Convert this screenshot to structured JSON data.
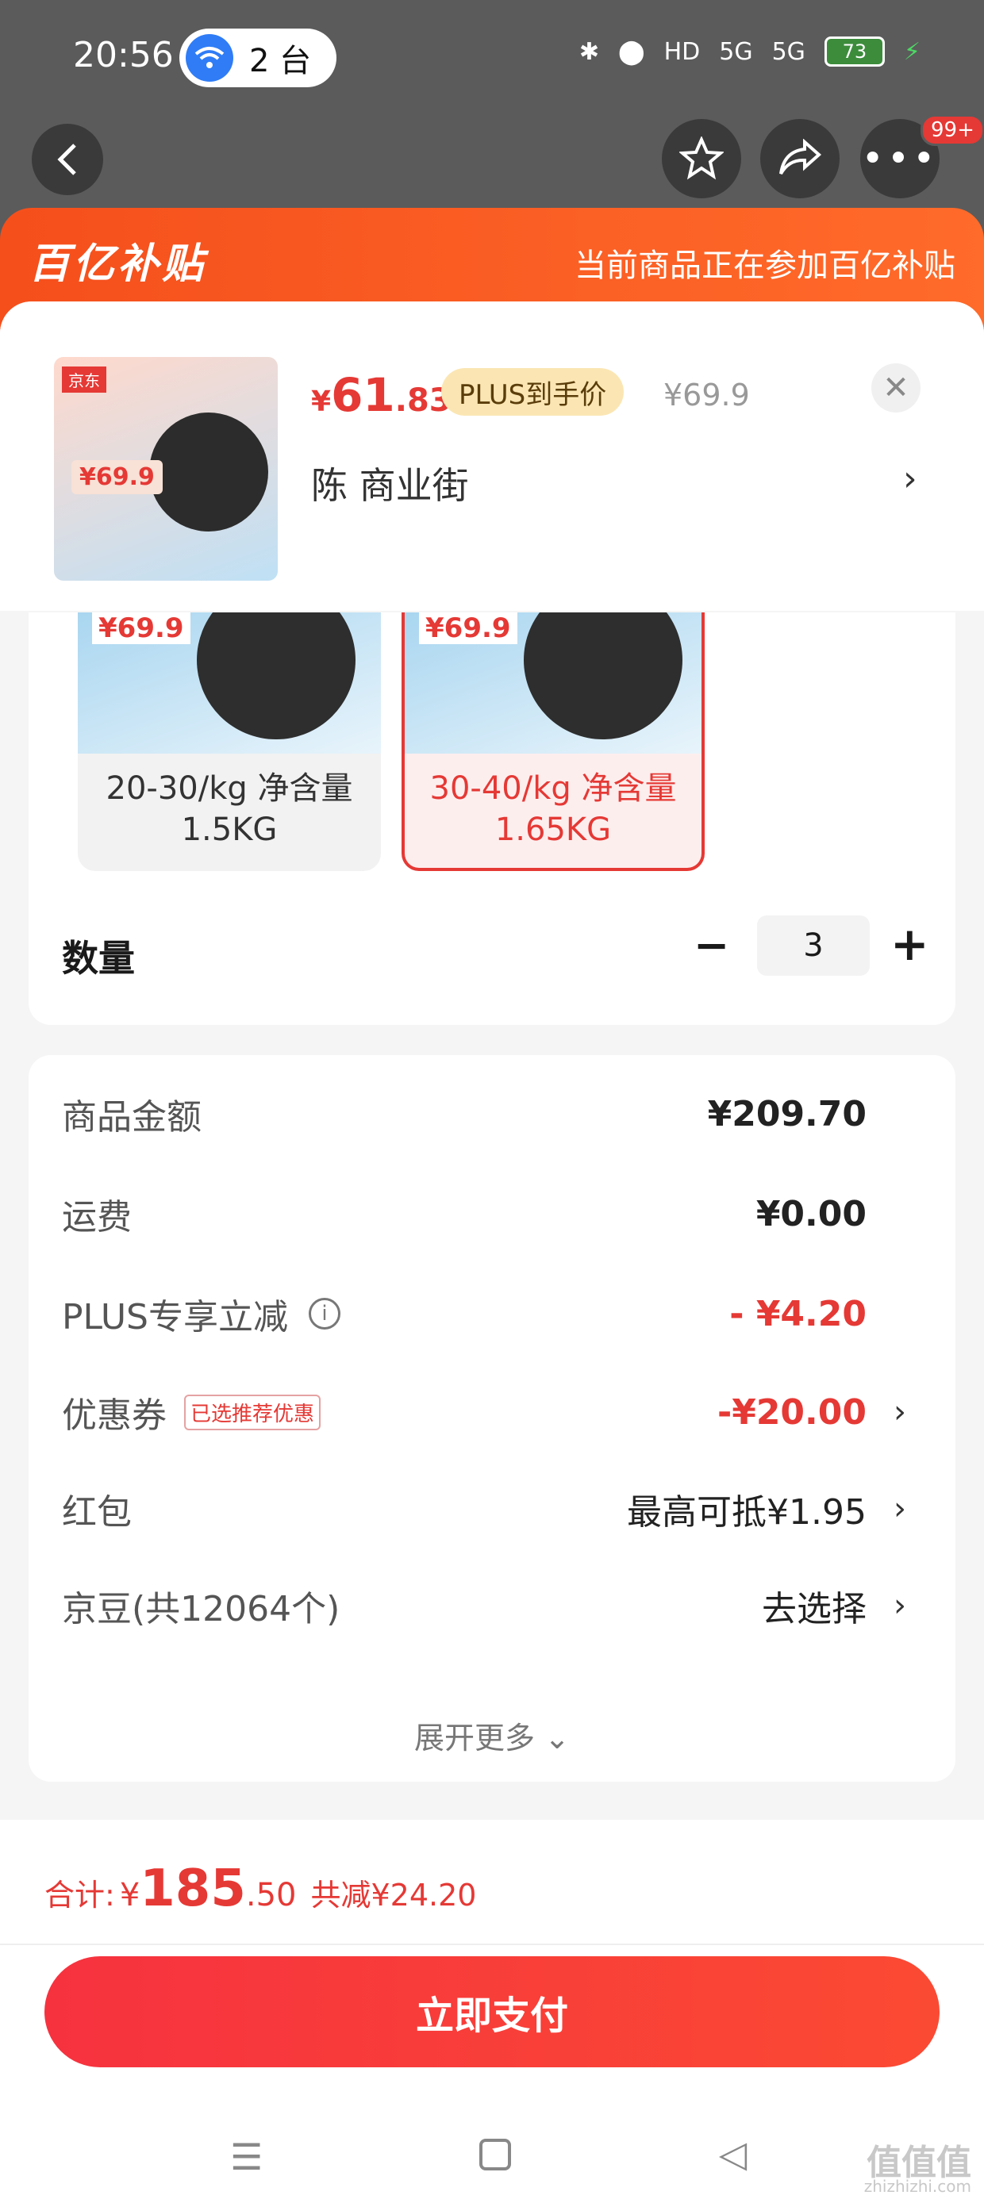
{
  "status_bar": {
    "time": "20:56",
    "cast_count": "2 台",
    "network_1": "5G",
    "network_2": "5G",
    "hd_badge": "HD",
    "battery": "73"
  },
  "nav": {
    "more_badge": "99+"
  },
  "banner": {
    "logo": "百亿补贴",
    "note": "当前商品正在参加百亿补贴"
  },
  "product": {
    "thumb_store": "京东",
    "thumb_price": "¥69.9",
    "price_symbol": "¥",
    "price_int": "61",
    "price_dec": ".83",
    "plus_tag": "PLUS到手价",
    "original_price": "¥69.9",
    "address": "陈  商业街"
  },
  "specs": {
    "options": [
      {
        "label": "20-30/kg 净含量1.5KG",
        "img_price": "¥69.9",
        "selected": false
      },
      {
        "label": "30-40/kg 净含量1.65KG",
        "img_price": "¥69.9",
        "selected": true
      }
    ]
  },
  "quantity": {
    "label": "数量",
    "value": "3"
  },
  "costs": {
    "goods_amount_label": "商品金额",
    "goods_amount": "¥209.70",
    "shipping_label": "运费",
    "shipping": "¥0.00",
    "plus_label": "PLUS专享立减",
    "plus_discount": "- ¥4.20",
    "coupon_label": "优惠券",
    "coupon_tag": "已选推荐优惠",
    "coupon_value": "-¥20.00",
    "redpacket_label": "红包",
    "redpacket_value": "最高可抵¥1.95",
    "jingdou_label": "京豆(共12064个)",
    "jingdou_value": "去选择",
    "expand": "展开更多"
  },
  "footer": {
    "total_label": "合计:",
    "total_symbol": "¥",
    "total_int": "185",
    "total_dec": ".50",
    "total_save": "共减¥24.20",
    "pay_button": "立即支付"
  },
  "watermark": {
    "main": "值值值",
    "sub": "zhizhizhi.com"
  }
}
